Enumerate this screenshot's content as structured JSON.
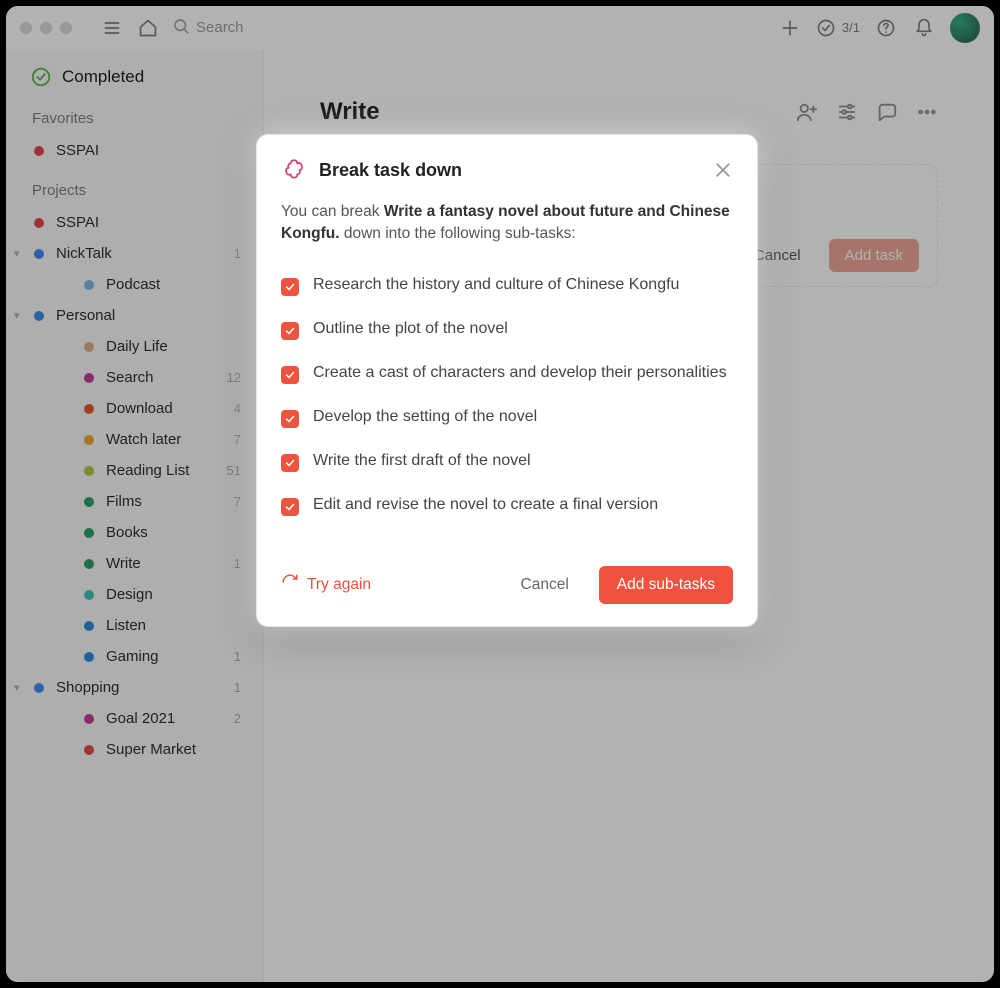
{
  "topbar": {
    "search_placeholder": "Search",
    "task_count": "3/1"
  },
  "sidebar": {
    "completed_label": "Completed",
    "favorites_label": "Favorites",
    "projects_label": "Projects",
    "favorites": [
      {
        "label": "SSPAI",
        "color": "#e24b47",
        "count": ""
      }
    ],
    "projects": [
      {
        "label": "SSPAI",
        "color": "#e24b47",
        "count": ""
      },
      {
        "label": "NickTalk",
        "color": "#3f8bf2",
        "count": "1",
        "children": [
          {
            "label": "Podcast",
            "color": "#7fb8e8",
            "count": ""
          }
        ]
      },
      {
        "label": "Personal",
        "color": "#3f8bf2",
        "count": "",
        "children": [
          {
            "label": "Daily Life",
            "color": "#d9b28f",
            "count": ""
          },
          {
            "label": "Search",
            "color": "#c33e96",
            "count": "12"
          },
          {
            "label": "Download",
            "color": "#e55a2e",
            "count": "4"
          },
          {
            "label": "Watch later",
            "color": "#f2a932",
            "count": "7"
          },
          {
            "label": "Reading List",
            "color": "#b9c43e",
            "count": "51"
          },
          {
            "label": "Films",
            "color": "#2da069",
            "count": "7"
          },
          {
            "label": "Books",
            "color": "#2da069",
            "count": ""
          },
          {
            "label": "Write",
            "color": "#2da069",
            "count": "1"
          },
          {
            "label": "Design",
            "color": "#43c4b7",
            "count": ""
          },
          {
            "label": "Listen",
            "color": "#2f8fe0",
            "count": ""
          },
          {
            "label": "Gaming",
            "color": "#2f8fe0",
            "count": "1"
          }
        ]
      },
      {
        "label": "Shopping",
        "color": "#3f8bf2",
        "count": "1",
        "children": [
          {
            "label": "Goal 2021",
            "color": "#c33e96",
            "count": "2"
          },
          {
            "label": "Super Market",
            "color": "#e24b47",
            "count": ""
          }
        ]
      }
    ]
  },
  "main": {
    "title": "Write",
    "cancel_label": "Cancel",
    "add_task_label": "Add task"
  },
  "modal": {
    "title": "Break task down",
    "desc_prefix": "You can break ",
    "desc_bold": "Write a fantasy novel about future and Chinese Kongfu.",
    "desc_suffix": " down into the following sub-tasks:",
    "subtasks": [
      "Research the history and culture of Chinese Kongfu",
      "Outline the plot of the novel",
      "Create a cast of characters and develop their personalities",
      "Develop the setting of the novel",
      "Write the first draft of the novel",
      "Edit and revise the novel to create a final version"
    ],
    "try_again_label": "Try again",
    "cancel_label": "Cancel",
    "add_subtasks_label": "Add sub-tasks"
  },
  "colors": {
    "accent": "#ef533f"
  }
}
